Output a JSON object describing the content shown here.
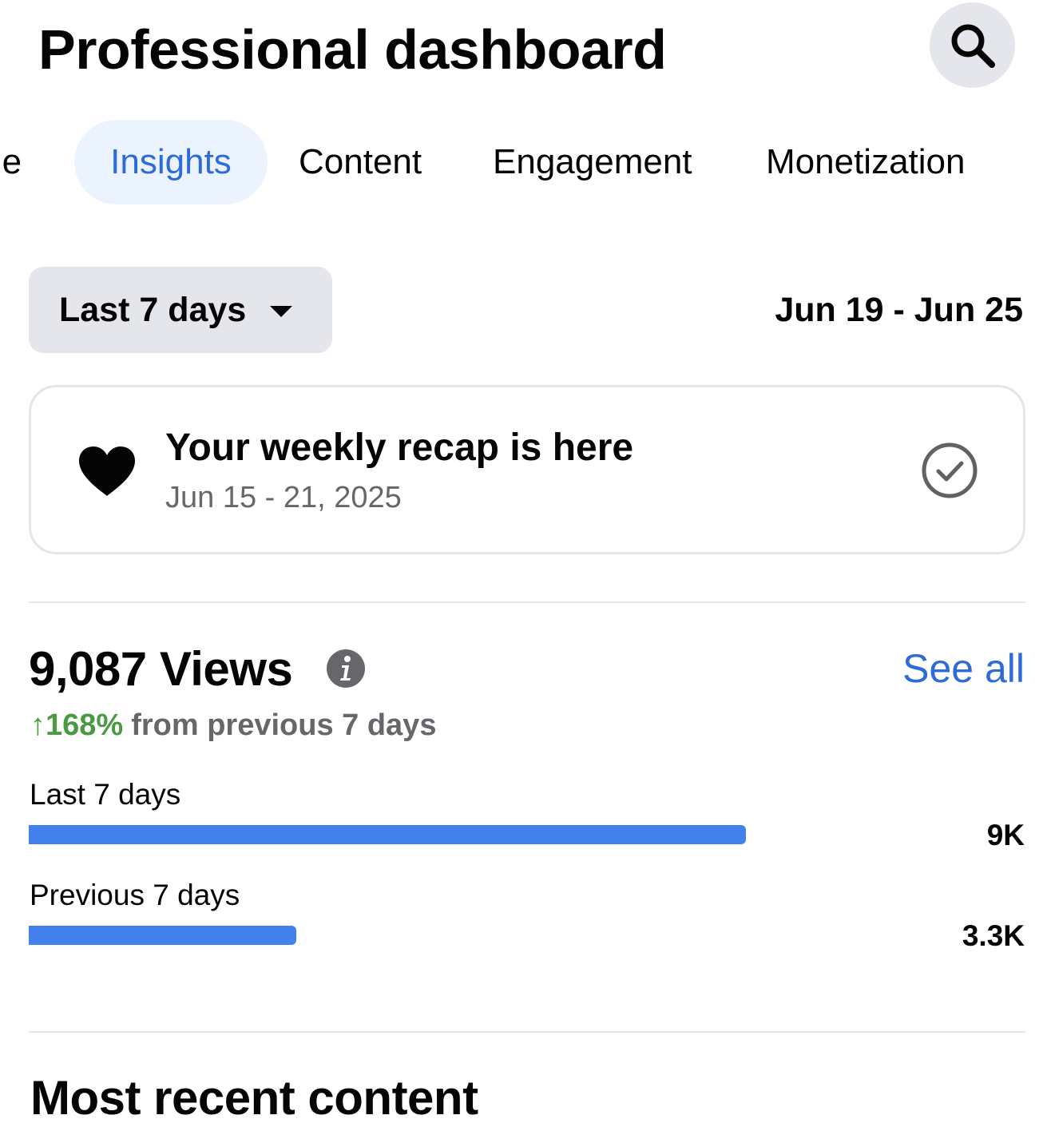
{
  "header": {
    "title": "Professional dashboard",
    "search_icon": "search-icon"
  },
  "tabs": [
    {
      "label": "Home",
      "visible_text": "me",
      "active": false
    },
    {
      "label": "Insights",
      "active": true
    },
    {
      "label": "Content",
      "active": false
    },
    {
      "label": "Engagement",
      "active": false
    },
    {
      "label": "Monetization",
      "active": false
    }
  ],
  "filter": {
    "selected": "Last 7 days",
    "date_range": "Jun 19 - Jun 25"
  },
  "recap": {
    "title": "Your weekly recap is here",
    "date": "Jun 15 - 21, 2025",
    "icon": "heart-icon",
    "status_icon": "check-circle-icon"
  },
  "views": {
    "title": "9,087 Views",
    "see_all": "See all",
    "change_pct": "↑168%",
    "change_text": "from previous 7 days"
  },
  "chart_data": {
    "type": "bar",
    "orientation": "horizontal",
    "categories": [
      "Last 7 days",
      "Previous 7 days"
    ],
    "values": [
      9087,
      3390
    ],
    "value_labels": [
      "9K",
      "3.3K"
    ],
    "xlim": [
      0,
      9087
    ],
    "color": "#4281ec"
  },
  "recent": {
    "title": "Most recent content"
  },
  "colors": {
    "accent": "#2d6bd8",
    "positive": "#4a9a42",
    "bar": "#4281ec",
    "muted": "#65676b"
  }
}
